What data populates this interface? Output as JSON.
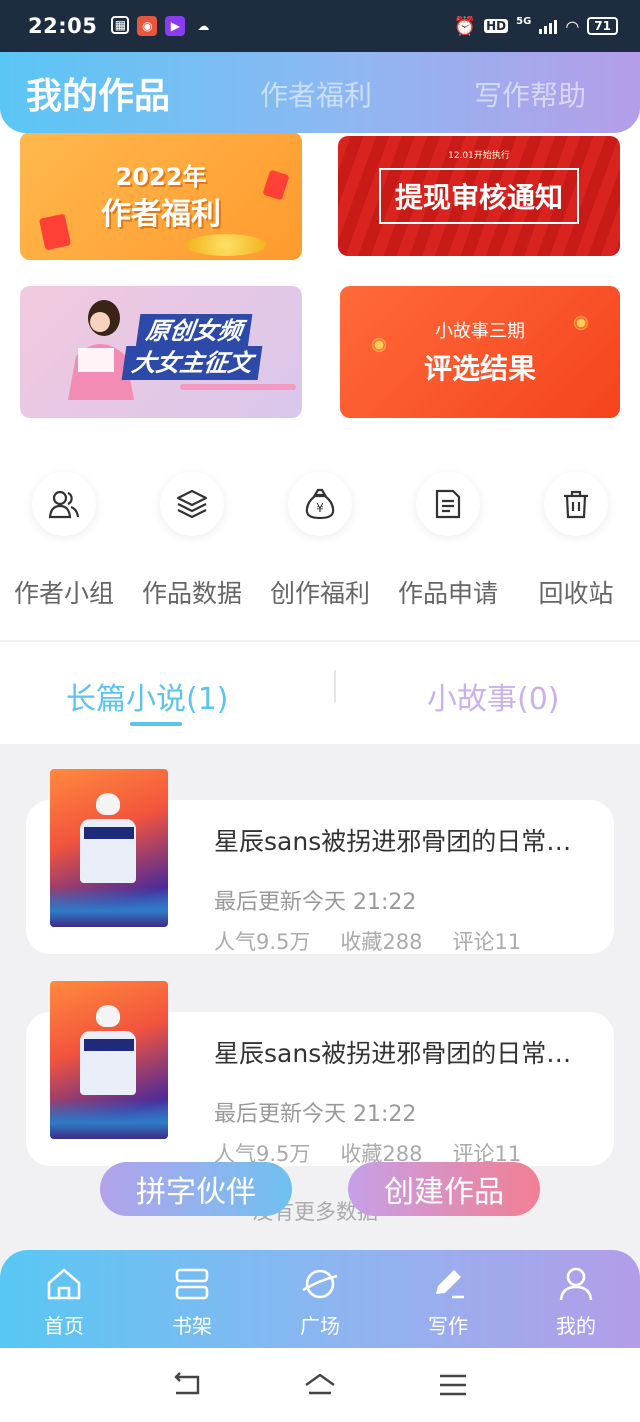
{
  "status_bar": {
    "time": "22:05",
    "hd": "HD",
    "network": "5G",
    "battery": "71"
  },
  "header": {
    "tabs": [
      "我的作品",
      "作者福利",
      "写作帮助"
    ],
    "active_tab": "我的作品"
  },
  "banners": {
    "welfare_2022": {
      "year": "2022年",
      "title": "作者福利"
    },
    "withdraw_notice": {
      "small": "12.01开始执行",
      "title": "提现审核通知"
    },
    "original_female": {
      "line1": "原创女频",
      "line2": "大女主征文"
    },
    "short_story": {
      "line1": "小故事三期",
      "line2": "评选结果"
    }
  },
  "quick_entries": [
    {
      "label": "作者小组",
      "icon": "users-icon"
    },
    {
      "label": "作品数据",
      "icon": "layers-icon"
    },
    {
      "label": "创作福利",
      "icon": "money-bag-icon"
    },
    {
      "label": "作品申请",
      "icon": "document-icon"
    },
    {
      "label": "回收站",
      "icon": "trash-icon"
    }
  ],
  "work_tabs": {
    "novel": "长篇小说(1)",
    "short": "小故事(0)"
  },
  "works": [
    {
      "title": "星辰sans被拐进邪骨团的日常…",
      "updated": "最后更新今天 21:22",
      "popularity": "人气9.5万",
      "favorites": "收藏288",
      "comments": "评论11"
    },
    {
      "title": "星辰sans被拐进邪骨团的日常…",
      "updated": "最后更新今天 21:22",
      "popularity": "人气9.5万",
      "favorites": "收藏288",
      "comments": "评论11"
    }
  ],
  "floating_buttons": {
    "partner": "拼字伙伴",
    "create": "创建作品"
  },
  "no_more": "没有更多数据",
  "bottom_nav": [
    {
      "label": "首页",
      "icon": "home-icon"
    },
    {
      "label": "书架",
      "icon": "bookshelf-icon"
    },
    {
      "label": "广场",
      "icon": "planet-icon"
    },
    {
      "label": "写作",
      "icon": "pen-icon"
    },
    {
      "label": "我的",
      "icon": "user-icon"
    }
  ],
  "colors": {
    "accent_blue": "#5bc4ee",
    "accent_purple": "#b59de9",
    "create_pink": "#f27f93"
  }
}
